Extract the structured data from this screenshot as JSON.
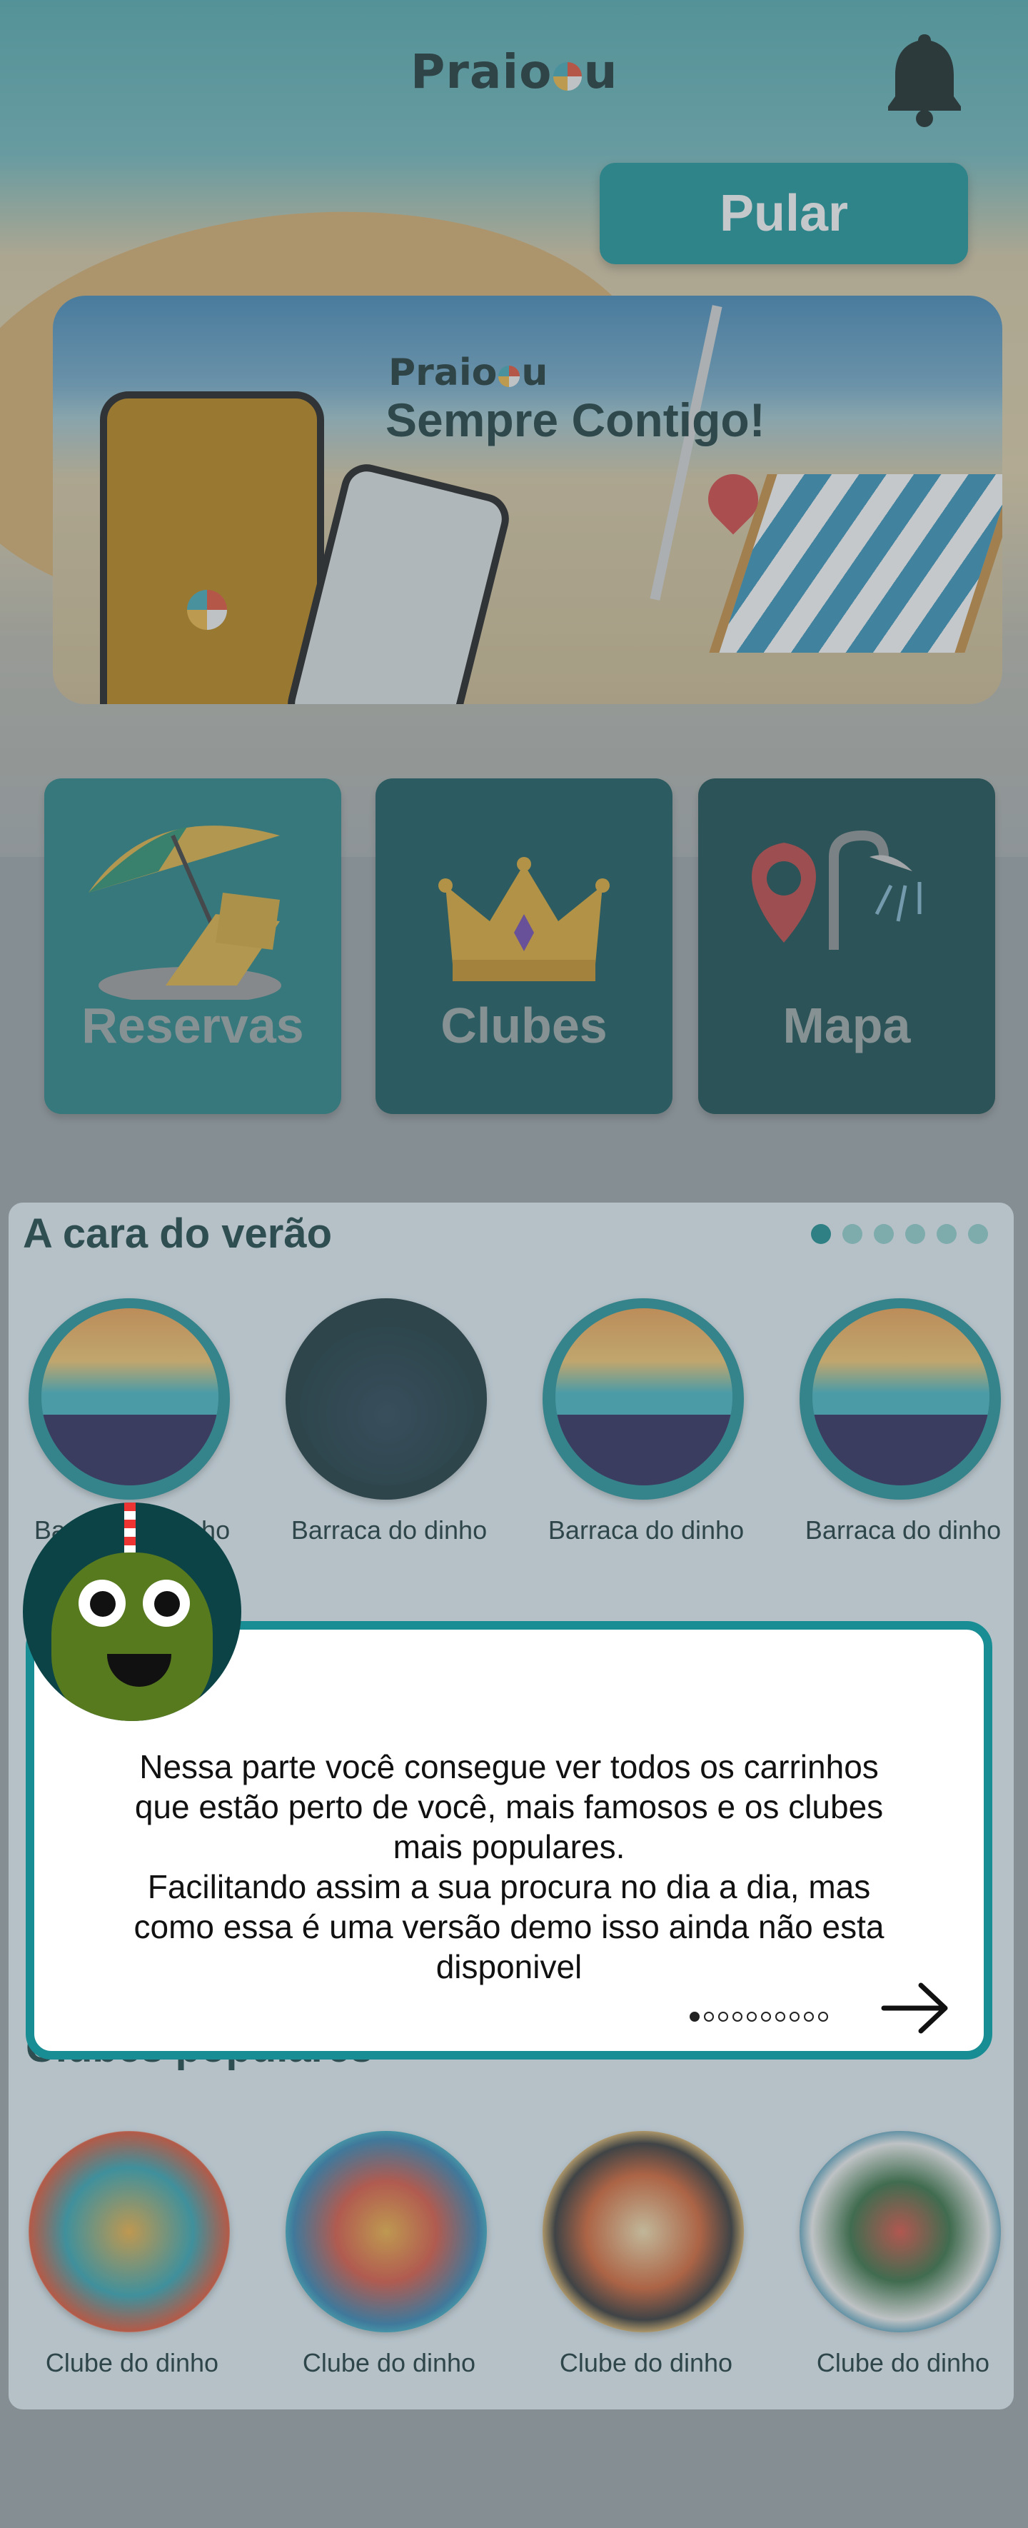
{
  "header": {
    "logo_text_a": "Praio",
    "logo_text_b": "u",
    "bell_icon": "bell-icon"
  },
  "skip_button": {
    "label": "Pular"
  },
  "banner": {
    "logo_text_a": "Praio",
    "logo_text_b": "u",
    "tagline": "Sempre Contigo!"
  },
  "tiles": [
    {
      "label": "Reservas",
      "icon": "umbrella-chair-icon"
    },
    {
      "label": "Clubes",
      "icon": "crown-icon"
    },
    {
      "label": "Mapa",
      "icon": "map-pin-shower-icon"
    }
  ],
  "summer": {
    "title": "A cara do verão",
    "dots": 6,
    "items": [
      {
        "name": "Barraca do dinho"
      },
      {
        "name": "Barraca do dinho"
      },
      {
        "name": "Barraca do dinho"
      },
      {
        "name": "Barraca do dinho"
      }
    ]
  },
  "clubs": {
    "title": "Clubes populares",
    "items": [
      {
        "name": "Clube do dinho"
      },
      {
        "name": "Clube do dinho"
      },
      {
        "name": "Clube do dinho"
      },
      {
        "name": "Clube do dinho"
      }
    ]
  },
  "tutorial": {
    "line1": "Nessa parte você consegue ver todos os carrinhos",
    "line2": "que estão perto de você, mais famosos e os clubes",
    "line3": "mais populares.",
    "line4": "Facilitando assim a sua procura no dia a dia, mas",
    "line5": "como essa é uma versão demo isso ainda não esta",
    "line6": "disponivel",
    "steps": 10,
    "current_step": 1
  },
  "colors": {
    "accent": "#0f9198",
    "dark_teal": "#0a4346",
    "card_bg": "#e7f4fb"
  }
}
